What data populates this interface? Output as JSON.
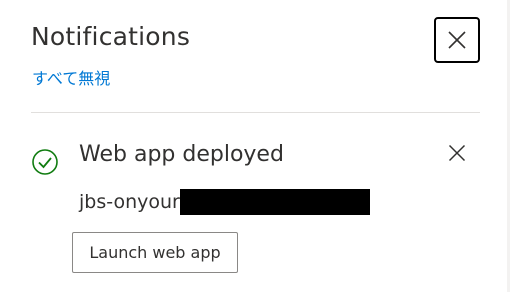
{
  "panel": {
    "title": "Notifications",
    "dismiss_all_label": "すべて無視",
    "close_icon": "close-icon"
  },
  "notification": {
    "status_icon": "checkmark-circle-icon",
    "status_color": "#107c10",
    "title": "Web app deployed",
    "resource_name_visible": "jbs-onyour",
    "action_label": "Launch web app",
    "close_icon": "close-icon"
  },
  "colors": {
    "link": "#0078d4",
    "text": "#323130",
    "success": "#107c10"
  }
}
